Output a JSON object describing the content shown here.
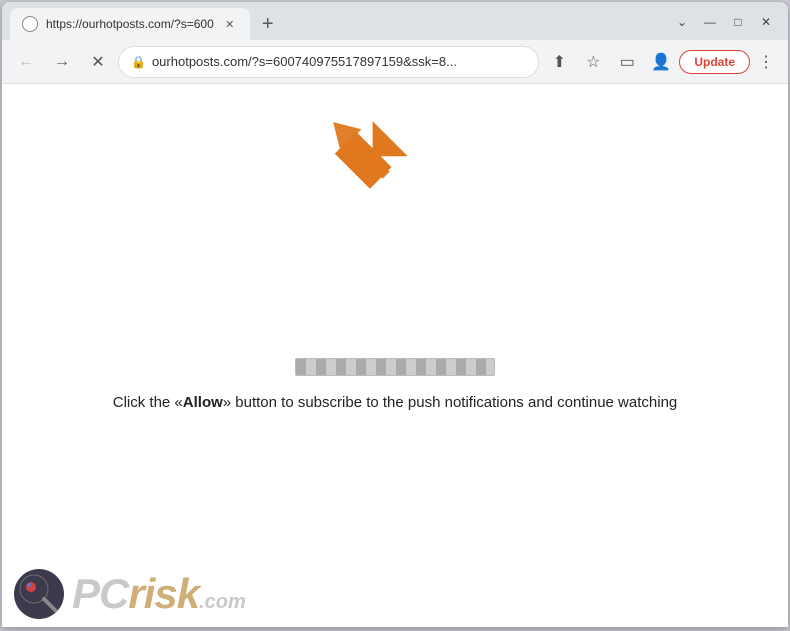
{
  "window": {
    "tab_title": "https://ourhotposts.com/?s=600",
    "url": "ourhotposts.com/?s=600740975517897159&ssk=8...",
    "full_url": "https://ourhotposts.com/?s=600740975517897159&ssk=8..."
  },
  "nav": {
    "back_label": "←",
    "forward_label": "→",
    "reload_label": "✕",
    "update_label": "Update"
  },
  "page": {
    "instruction_text": "Click the «Allow» button to subscribe to the push notifications and continue watching",
    "instruction_part1": "Click the «",
    "instruction_allow": "Allow",
    "instruction_part2": "» button to subscribe to the push notifications and continue watching"
  },
  "watermark": {
    "pc_text": "PC",
    "risk_text": "risk",
    "dotcom_text": ".com"
  },
  "icons": {
    "lock": "🔒",
    "share": "⬆",
    "bookmark": "☆",
    "sidebar": "▭",
    "profile": "👤",
    "minimize": "—",
    "maximize": "□",
    "close": "✕",
    "more": "⋮",
    "new_tab": "+"
  }
}
